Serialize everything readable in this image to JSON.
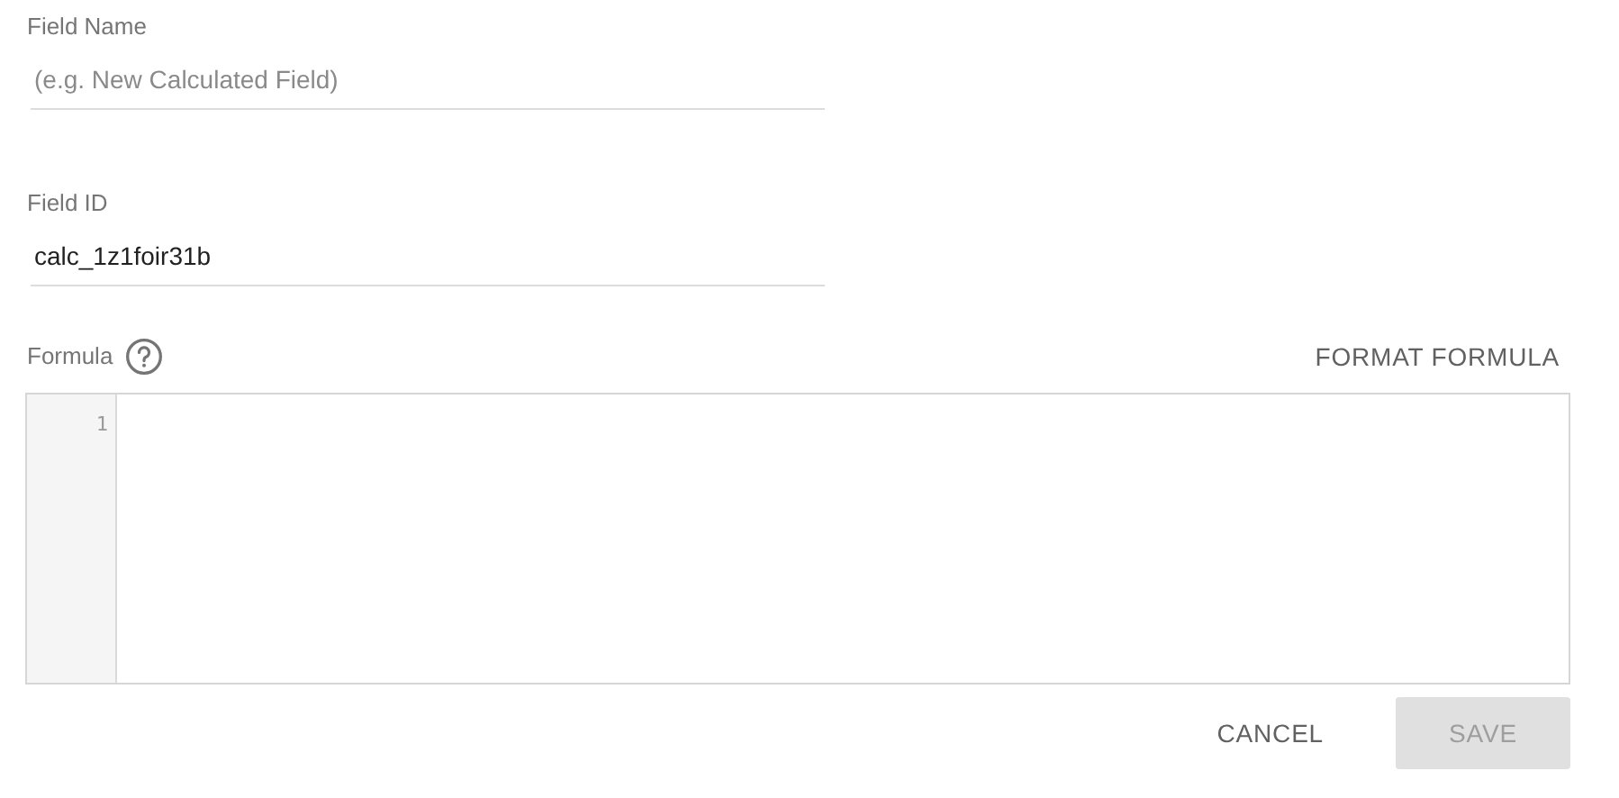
{
  "field_name": {
    "label": "Field Name",
    "placeholder": "(e.g. New Calculated Field)"
  },
  "field_id": {
    "label": "Field ID",
    "value": "calc_1z1foir31b"
  },
  "formula": {
    "label": "Formula",
    "format_button": "FORMAT FORMULA",
    "line_numbers": [
      "1"
    ]
  },
  "buttons": [
    {
      "label": "CANCEL",
      "kind": "text",
      "disabled": false
    },
    {
      "label": "SAVE",
      "kind": "filled",
      "disabled": true
    }
  ]
}
